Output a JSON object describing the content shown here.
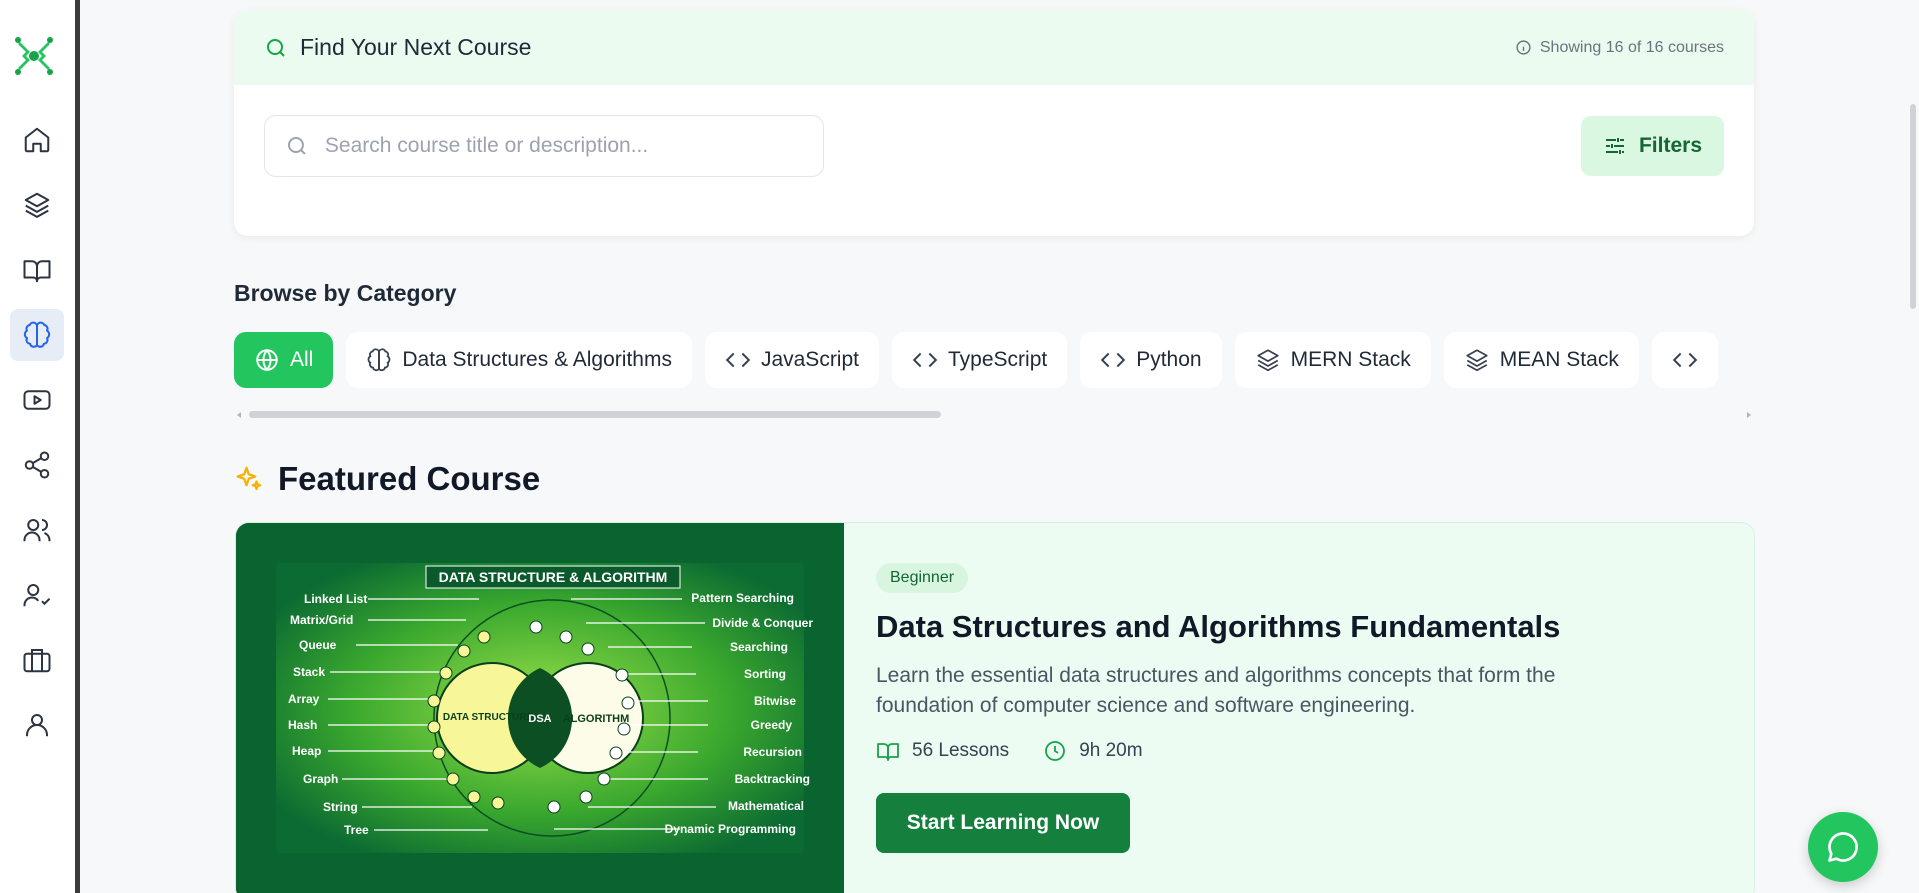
{
  "sidebar": {
    "items": [
      {
        "icon": "home-icon"
      },
      {
        "icon": "layers-icon"
      },
      {
        "icon": "book-open-icon"
      },
      {
        "icon": "brain-icon",
        "active": true
      },
      {
        "icon": "video-icon"
      },
      {
        "icon": "share-icon"
      },
      {
        "icon": "users-icon"
      },
      {
        "icon": "user-check-icon"
      },
      {
        "icon": "briefcase-icon"
      },
      {
        "icon": "user-icon"
      }
    ]
  },
  "search": {
    "title": "Find Your Next Course",
    "count": "Showing 16 of 16 courses",
    "placeholder": "Search course title or description...",
    "filters_label": "Filters"
  },
  "categories": {
    "title": "Browse by Category",
    "items": [
      {
        "label": "All",
        "icon": "globe-icon",
        "active": true
      },
      {
        "label": "Data Structures & Algorithms",
        "icon": "brain-icon"
      },
      {
        "label": "JavaScript",
        "icon": "code-icon"
      },
      {
        "label": "TypeScript",
        "icon": "code-icon"
      },
      {
        "label": "Python",
        "icon": "code-icon"
      },
      {
        "label": "MERN Stack",
        "icon": "layers-icon"
      },
      {
        "label": "MEAN Stack",
        "icon": "layers-icon"
      }
    ]
  },
  "featured": {
    "section_title": "Featured Course",
    "image": {
      "banner": "DATA STRUCTURE & ALGORITHM",
      "left_circle": "DATA STRUCTURE",
      "right_circle": "ALGORITHM",
      "center": "DSA",
      "left_labels": [
        "Linked List",
        "Matrix/Grid",
        "Queue",
        "Stack",
        "Array",
        "Hash",
        "Heap",
        "Graph",
        "String",
        "Tree"
      ],
      "right_labels": [
        "Pattern Searching",
        "Divide & Conquer",
        "Searching",
        "Sorting",
        "Bitwise",
        "Greedy",
        "Recursion",
        "Backtracking",
        "Mathematical",
        "Dynamic Programming"
      ]
    },
    "level": "Beginner",
    "title": "Data Structures and Algorithms Fundamentals",
    "description": "Learn the essential data structures and algorithms concepts that form the foundation of computer science and software engineering.",
    "lessons": "56 Lessons",
    "duration": "9h 20m",
    "cta": "Start Learning Now"
  },
  "colors": {
    "accent": "#22c55e",
    "accent_dark": "#15803d",
    "header_tint": "#ecfbef",
    "active_nav": "#e6edf7"
  }
}
